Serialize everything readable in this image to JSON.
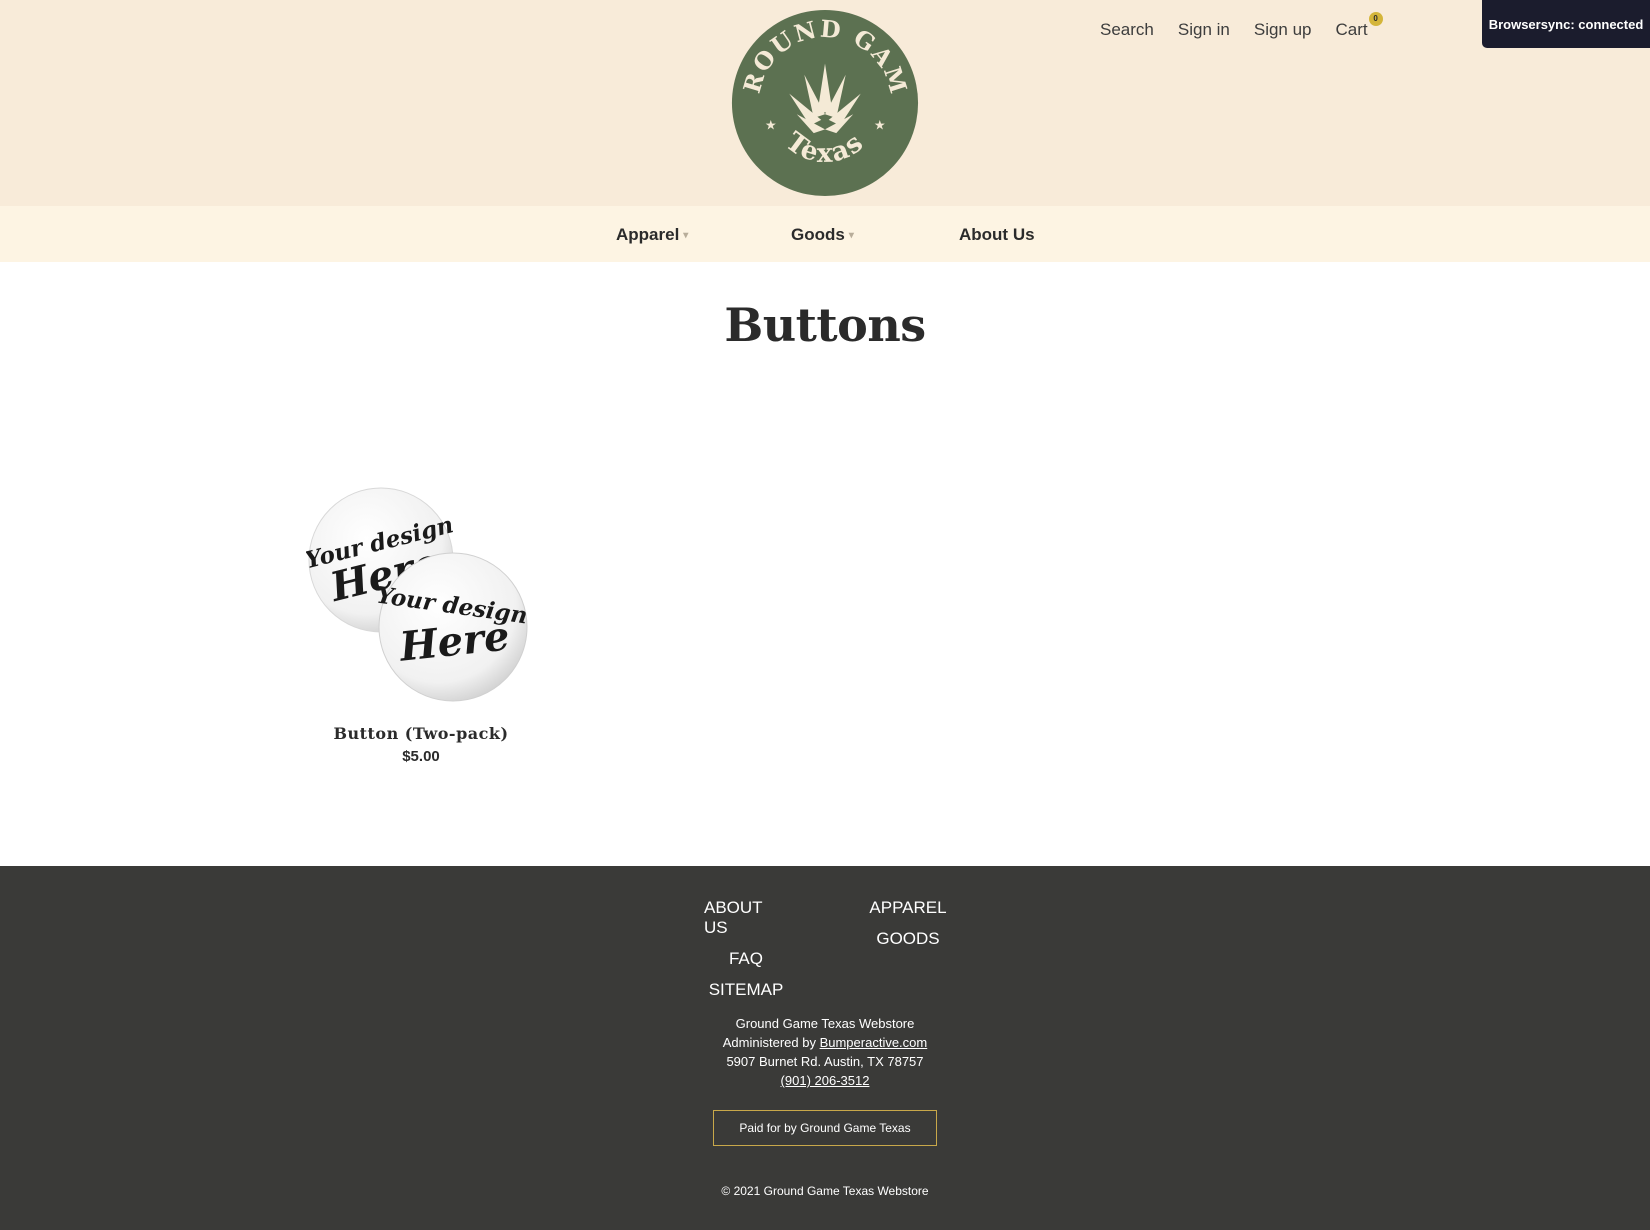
{
  "header": {
    "logo_top_text": "GROUND GAME",
    "logo_bottom_text": "Texas",
    "logo_color": "#5c7151",
    "logo_text_color": "#f4ead6"
  },
  "top_links": {
    "search": "Search",
    "sign_in": "Sign in",
    "sign_up": "Sign up",
    "cart": "Cart",
    "cart_count": "0"
  },
  "browsersync": "Browsersync: connected",
  "nav": {
    "apparel": "Apparel",
    "goods": "Goods",
    "about": "About Us"
  },
  "page_title": "Buttons",
  "products": [
    {
      "name": "Button (Two-pack)",
      "price": "$5.00",
      "image_text_1": "Your design",
      "image_text_2": "Here"
    }
  ],
  "footer": {
    "col1": [
      "ABOUT US",
      "FAQ",
      "SITEMAP"
    ],
    "col2": [
      "APPAREL",
      "GOODS"
    ],
    "store_name": "Ground Game Texas Webstore",
    "administered_prefix": "Administered by ",
    "administered_link": "Bumperactive.com",
    "address": "5907 Burnet Rd. Austin, TX 78757",
    "phone": "(901) 206-3512",
    "paid_for": "Paid for by Ground Game Texas",
    "copyright": "© 2021 Ground Game Texas Webstore"
  }
}
